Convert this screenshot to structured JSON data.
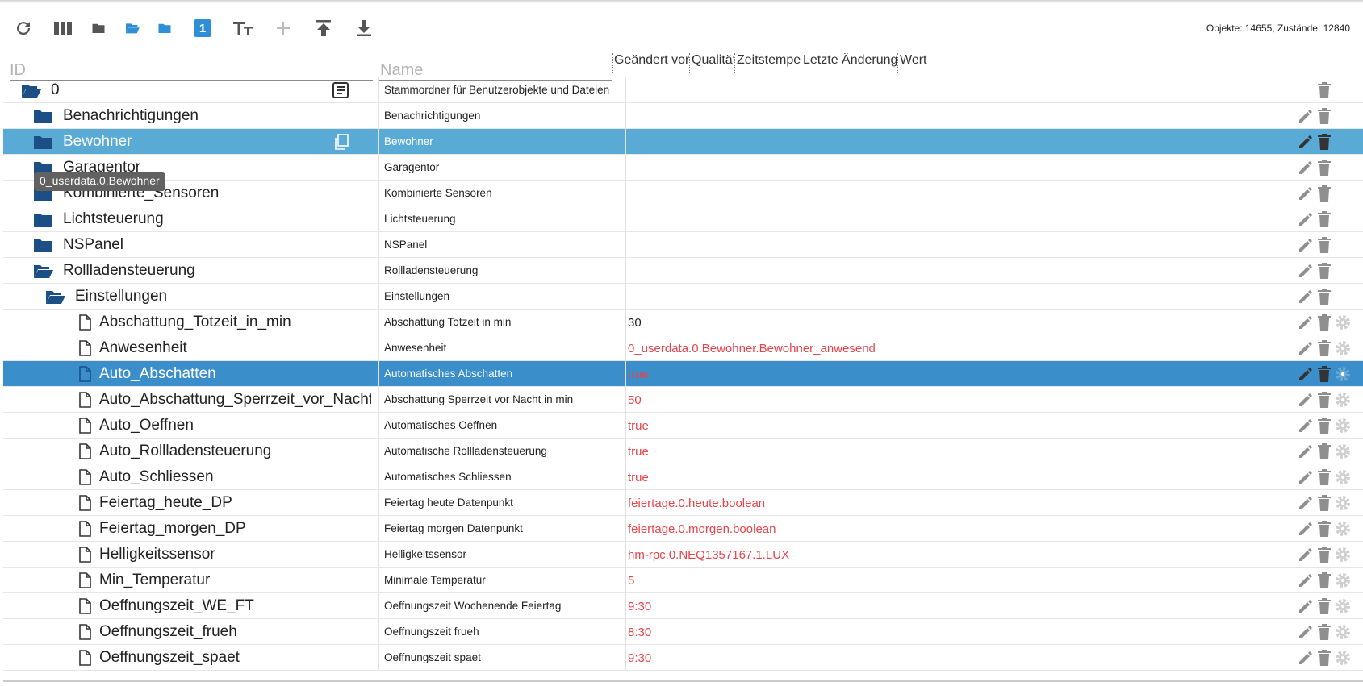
{
  "toolbar": {
    "buttons": [
      {
        "name": "refresh-icon",
        "color": "#555"
      },
      {
        "name": "columns-icon",
        "color": "#555"
      },
      {
        "name": "folder-icon",
        "color": "#555"
      },
      {
        "name": "folder-open-icon",
        "color": "#2f8fd6"
      },
      {
        "name": "folder-blue-icon",
        "color": "#2f8fd6"
      },
      {
        "name": "expert-mode-icon",
        "color": "#2f8fd6"
      },
      {
        "name": "text-size-icon",
        "color": "#555"
      },
      {
        "name": "add-icon",
        "color": "#bbb"
      },
      {
        "name": "upload-icon",
        "color": "#555"
      },
      {
        "name": "download-icon",
        "color": "#555"
      }
    ],
    "expert_badge": "1",
    "stats_objects": "Objekte: 14655",
    "stats_states": "Zustände: 12840"
  },
  "header": {
    "id_placeholder": "ID",
    "name_placeholder": "Name",
    "col_changed_by": "Geändert von",
    "col_quality": "Qualität",
    "col_timestamp": "Zeitstempel",
    "col_last_change": "Letzte Änderung",
    "col_value": "Wert"
  },
  "tooltip": "0_userdata.0.Bewohner",
  "colors": {
    "folder": "#1b4f86",
    "selection_light": "#5aaad6",
    "selection_dark": "#3a8fcb",
    "value_red": "#e8444a"
  },
  "rows": [
    {
      "id": "0",
      "name": "Stammordner für Benutzerobjekte und Dateien",
      "value": "",
      "type": "folder-open",
      "indent": 0,
      "state": ""
    },
    {
      "id": "Benachrichtigungen",
      "name": "Benachrichtigungen",
      "value": "",
      "type": "folder",
      "indent": 1,
      "state": ""
    },
    {
      "id": "Bewohner",
      "name": "Bewohner",
      "value": "",
      "type": "folder",
      "indent": 1,
      "state": "sel-light"
    },
    {
      "id": "Garagentor",
      "name": "Garagentor",
      "value": "",
      "type": "folder",
      "indent": 1,
      "state": ""
    },
    {
      "id": "Kombinierte_Sensoren",
      "name": "Kombinierte Sensoren",
      "value": "",
      "type": "folder",
      "indent": 1,
      "state": ""
    },
    {
      "id": "Lichtsteuerung",
      "name": "Lichtsteuerung",
      "value": "",
      "type": "folder",
      "indent": 1,
      "state": ""
    },
    {
      "id": "NSPanel",
      "name": "NSPanel",
      "value": "",
      "type": "folder",
      "indent": 1,
      "state": ""
    },
    {
      "id": "Rollladensteuerung",
      "name": "Rollladensteuerung",
      "value": "",
      "type": "folder-open",
      "indent": 1,
      "state": ""
    },
    {
      "id": "Einstellungen",
      "name": "Einstellungen",
      "value": "",
      "type": "folder-open",
      "indent": 2,
      "state": ""
    },
    {
      "id": "Abschattung_Totzeit_in_min",
      "name": "Abschattung Totzeit in min",
      "value": "30",
      "type": "file",
      "indent": 3,
      "state": "",
      "plain": true
    },
    {
      "id": "Anwesenheit",
      "name": "Anwesenheit",
      "value": "0_userdata.0.Bewohner.Bewohner_anwesend",
      "type": "file",
      "indent": 3,
      "state": ""
    },
    {
      "id": "Auto_Abschatten",
      "name": "Automatisches Abschatten",
      "value": "true",
      "type": "file",
      "indent": 3,
      "state": "sel-dark"
    },
    {
      "id": "Auto_Abschattung_Sperrzeit_vor_Nacht_in_min",
      "name": "Abschattung Sperrzeit vor Nacht in min",
      "value": "50",
      "type": "file",
      "indent": 3,
      "state": ""
    },
    {
      "id": "Auto_Oeffnen",
      "name": "Automatisches Oeffnen",
      "value": "true",
      "type": "file",
      "indent": 3,
      "state": ""
    },
    {
      "id": "Auto_Rollladensteuerung",
      "name": "Automatische Rollladensteuerung",
      "value": "true",
      "type": "file",
      "indent": 3,
      "state": ""
    },
    {
      "id": "Auto_Schliessen",
      "name": "Automatisches Schliessen",
      "value": "true",
      "type": "file",
      "indent": 3,
      "state": ""
    },
    {
      "id": "Feiertag_heute_DP",
      "name": "Feiertag heute Datenpunkt",
      "value": "feiertage.0.heute.boolean",
      "type": "file",
      "indent": 3,
      "state": ""
    },
    {
      "id": "Feiertag_morgen_DP",
      "name": "Feiertag morgen Datenpunkt",
      "value": "feiertage.0.morgen.boolean",
      "type": "file",
      "indent": 3,
      "state": ""
    },
    {
      "id": "Helligkeitssensor",
      "name": "Helligkeitssensor",
      "value": "hm-rpc.0.NEQ1357167.1.LUX",
      "type": "file",
      "indent": 3,
      "state": ""
    },
    {
      "id": "Min_Temperatur",
      "name": "Minimale Temperatur",
      "value": "5",
      "type": "file",
      "indent": 3,
      "state": ""
    },
    {
      "id": "Oeffnungszeit_WE_FT",
      "name": "Oeffnungszeit Wochenende Feiertag",
      "value": "9:30",
      "type": "file",
      "indent": 3,
      "state": ""
    },
    {
      "id": "Oeffnungszeit_frueh",
      "name": "Oeffnungszeit frueh",
      "value": "8:30",
      "type": "file",
      "indent": 3,
      "state": ""
    },
    {
      "id": "Oeffnungszeit_spaet",
      "name": "Oeffnungszeit spaet",
      "value": "9:30",
      "type": "file",
      "indent": 3,
      "state": ""
    }
  ]
}
